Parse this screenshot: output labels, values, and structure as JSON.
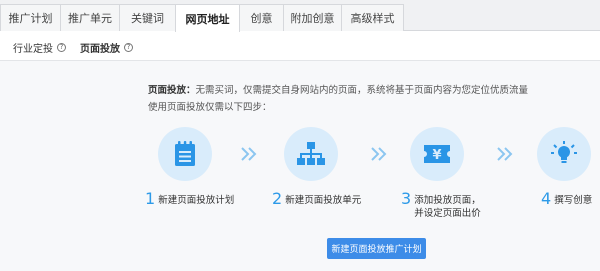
{
  "tabs": [
    {
      "label": "推广计划"
    },
    {
      "label": "推广单元"
    },
    {
      "label": "关键词"
    },
    {
      "label": "网页地址",
      "active": true
    },
    {
      "label": "创意"
    },
    {
      "label": "附加创意"
    },
    {
      "label": "高级样式"
    }
  ],
  "subtabs": [
    {
      "label": "行业定投",
      "icon": "help-icon"
    },
    {
      "label": "页面投放",
      "icon": "help-icon",
      "active": true
    }
  ],
  "intro": {
    "lead": "页面投放：",
    "text": "无需买词，仅需提交自身网站内的页面，系统将基于页面内容为您定位优质流量",
    "line2": "使用页面投放仅需以下四步："
  },
  "steps": [
    {
      "num": "1",
      "label": "新建页面投放计划",
      "icon": "notepad-icon"
    },
    {
      "num": "2",
      "label": "新建页面投放单元",
      "icon": "hierarchy-icon"
    },
    {
      "num": "3",
      "label": "添加投放页面，",
      "label2": "并设定页面出价",
      "icon": "yen-ticket-icon"
    },
    {
      "num": "4",
      "label": "撰写创意",
      "icon": "lightbulb-icon"
    }
  ],
  "cta": {
    "label": "新建页面投放推广计划"
  },
  "colors": {
    "accent": "#2d9ae8",
    "circle_bg": "#d9ecfb",
    "icon": "#2a95e6",
    "button": "#3d8ce8"
  }
}
